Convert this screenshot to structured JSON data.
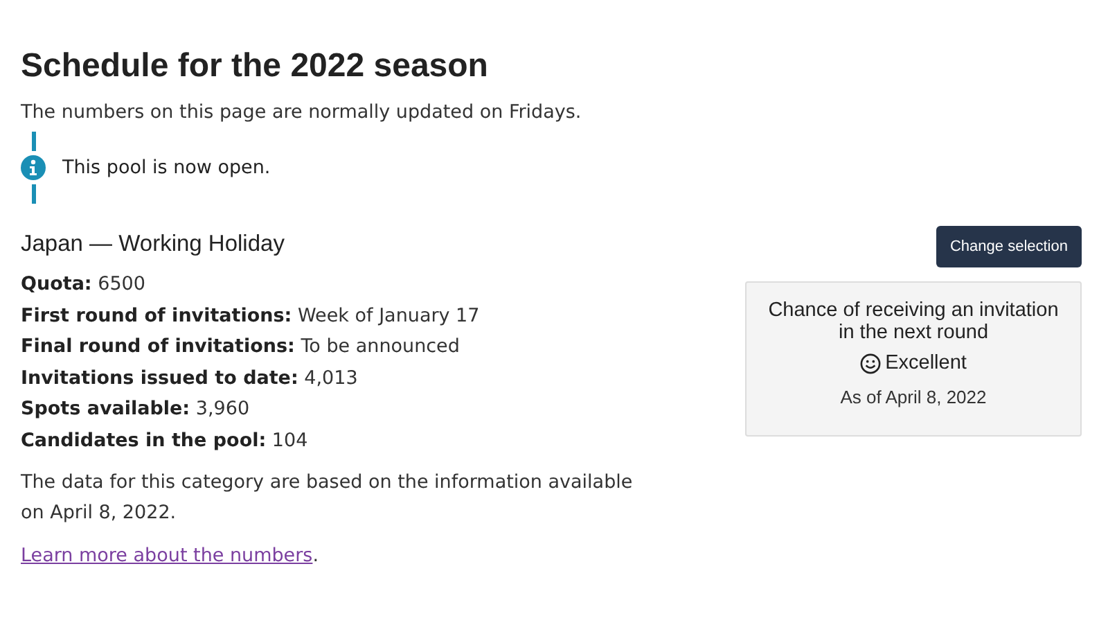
{
  "title": "Schedule for the 2022 season",
  "intro": "The numbers on this page are normally updated on Fridays.",
  "notice": {
    "kind": "info",
    "text": "This pool is now open."
  },
  "category": {
    "heading": "Japan — Working Holiday",
    "button": "Change selection",
    "facts": [
      {
        "label": "Quota:",
        "value": "6500"
      },
      {
        "label": "First round of invitations:",
        "value": "Week of January 17"
      },
      {
        "label": "Final round of invitations:",
        "value": "To be announced"
      },
      {
        "label": "Invitations issued to date:",
        "value": "4,013"
      },
      {
        "label": "Spots available:",
        "value": "3,960"
      },
      {
        "label": "Candidates in the pool:",
        "value": "104"
      }
    ],
    "note": "The data for this category are based on the information available on April 8, 2022.",
    "more": {
      "link": "Learn more about the numbers",
      "after": "."
    }
  },
  "chance": {
    "heading": "Chance of receiving an invitation in the next round",
    "rating": "Excellent",
    "date": "As of April 8, 2022"
  }
}
